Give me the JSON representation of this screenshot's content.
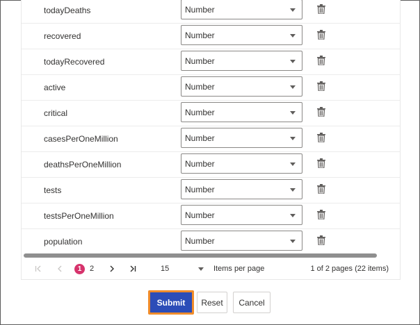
{
  "fields": [
    {
      "name": "todayDeaths",
      "type": "Number"
    },
    {
      "name": "recovered",
      "type": "Number"
    },
    {
      "name": "todayRecovered",
      "type": "Number"
    },
    {
      "name": "active",
      "type": "Number"
    },
    {
      "name": "critical",
      "type": "Number"
    },
    {
      "name": "casesPerOneMillion",
      "type": "Number"
    },
    {
      "name": "deathsPerOneMillion",
      "type": "Number"
    },
    {
      "name": "tests",
      "type": "Number"
    },
    {
      "name": "testsPerOneMillion",
      "type": "Number"
    },
    {
      "name": "population",
      "type": "Number"
    }
  ],
  "pagination": {
    "first_icon": "first-page-icon",
    "prev_icon": "previous-page-icon",
    "next_icon": "next-page-icon",
    "last_icon": "last-page-icon",
    "pages": [
      "1",
      "2"
    ],
    "current_page": "1",
    "page_size": "15",
    "items_per_page_label": "Items per page",
    "info": "1 of 2 pages (22 items)"
  },
  "actions": {
    "submit_label": "Submit",
    "reset_label": "Reset",
    "cancel_label": "Cancel"
  },
  "colors": {
    "primary": "#2c4db8",
    "focus_outline": "#f08c2b",
    "current_page": "#d6336c"
  }
}
